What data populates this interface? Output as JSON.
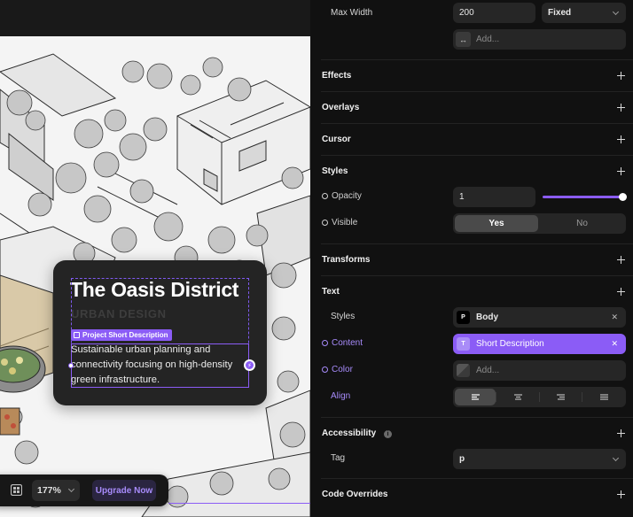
{
  "canvas": {
    "card": {
      "title": "The Oasis District",
      "subtitle": "URBAN DESIGN",
      "selection_tag": "Project Short Description",
      "body": "Sustainable urban planning and connectivity focusing on high-density green infrastructure."
    },
    "toolbar": {
      "zoom": "177%",
      "upgrade_label": "Upgrade Now"
    }
  },
  "panel": {
    "max_width": {
      "label": "Max Width",
      "value": "200",
      "mode": "Fixed",
      "add_placeholder": "Add..."
    },
    "sections": {
      "effects": "Effects",
      "overlays": "Overlays",
      "cursor": "Cursor",
      "styles": "Styles",
      "transforms": "Transforms",
      "text": "Text",
      "accessibility": "Accessibility",
      "code_overrides": "Code Overrides"
    },
    "opacity": {
      "label": "Opacity",
      "value": "1",
      "slider_fraction": 1.0
    },
    "visible": {
      "label": "Visible",
      "yes": "Yes",
      "no": "No"
    },
    "text": {
      "styles_label": "Styles",
      "styles_value": "Body",
      "styles_chip": "P",
      "content_label": "Content",
      "content_value": "Short Description",
      "content_chip": "T",
      "color_label": "Color",
      "color_placeholder": "Add...",
      "align_label": "Align"
    },
    "accessibility": {
      "tag_label": "Tag",
      "tag_value": "p"
    },
    "colors": {
      "accent": "#8b5cf6",
      "panel_bg": "#111111",
      "field_bg": "#262626"
    }
  }
}
